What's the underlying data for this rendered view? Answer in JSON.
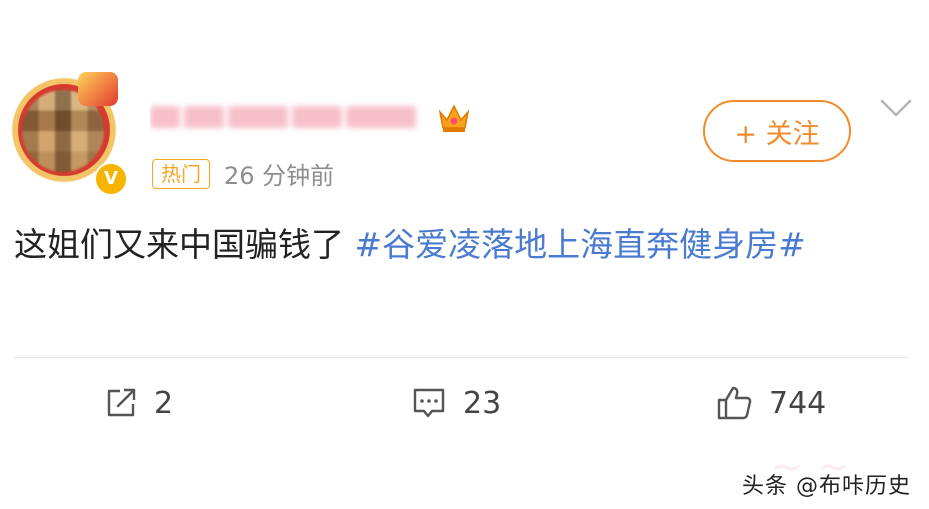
{
  "post": {
    "hot_tag": "热门",
    "time": "26 分钟前",
    "follow_label": "+ 关注",
    "text": "这姐们又来中国骗钱了 ",
    "hashtag": "#谷爱凌落地上海直奔健身房#"
  },
  "actions": {
    "share_count": "2",
    "comment_count": "23",
    "like_count": "744"
  },
  "watermark": {
    "text": "头条 @布咔历史"
  },
  "colors": {
    "accent_orange": "#f28b2b",
    "hashtag_blue": "#4a7bd0",
    "hot_tag": "#f5a623",
    "text_main": "#222222",
    "text_muted": "#8e8e8e"
  },
  "icons": {
    "verified": "v-badge-icon",
    "crown": "crown-icon",
    "more": "chevron-down-icon",
    "share": "share-icon",
    "comment": "comment-icon",
    "like": "thumbs-up-icon"
  }
}
